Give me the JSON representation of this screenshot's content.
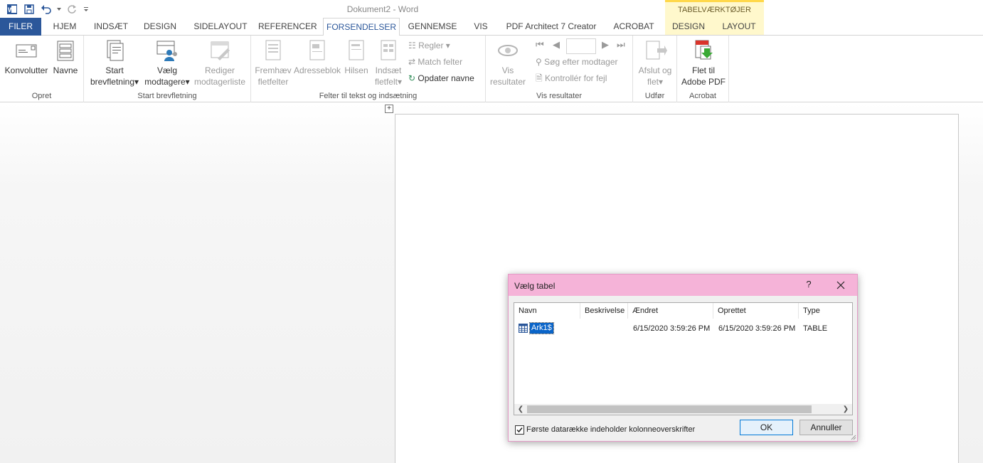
{
  "qat": {
    "icons": [
      "word-icon",
      "save-icon",
      "undo-icon",
      "undo-dropdown-icon",
      "redo-icon",
      "customize-qat-icon"
    ]
  },
  "window": {
    "title": "Dokument2 - Word"
  },
  "contextual": {
    "header": "TABELVÆRKTØJER"
  },
  "tabs": [
    {
      "label": "FILER"
    },
    {
      "label": "HJEM"
    },
    {
      "label": "INDSÆT"
    },
    {
      "label": "DESIGN"
    },
    {
      "label": "SIDELAYOUT"
    },
    {
      "label": "REFERENCER"
    },
    {
      "label": "FORSENDELSER"
    },
    {
      "label": "GENNEMSE"
    },
    {
      "label": "VIS"
    },
    {
      "label": "PDF Architect 7 Creator"
    },
    {
      "label": "ACROBAT"
    },
    {
      "label": "DESIGN"
    },
    {
      "label": "LAYOUT"
    }
  ],
  "ribbon": {
    "opret": {
      "label": "Opret",
      "konvolutter": "Konvolutter",
      "navne": "Navne"
    },
    "start": {
      "label": "Start brevfletning",
      "start_l1": "Start",
      "start_l2": "brevfletning",
      "vaelg_l1": "Vælg",
      "vaelg_l2": "modtagere",
      "rediger_l1": "Rediger",
      "rediger_l2": "modtagerliste"
    },
    "felter": {
      "label": "Felter til tekst og indsætning",
      "fremhaev_l1": "Fremhæv",
      "fremhaev_l2": "fletfelter",
      "adresseblok": "Adresseblok",
      "hilsen": "Hilsen",
      "indsaet_l1": "Indsæt",
      "indsaet_l2": "fletfelt",
      "regler": "Regler",
      "match": "Match felter",
      "opdater": "Opdater navne"
    },
    "vis": {
      "label": "Vis resultater",
      "vis_l1": "Vis",
      "vis_l2": "resultater",
      "soeg": "Søg efter modtager",
      "kontroller": "Kontrollér for fejl"
    },
    "udfoer": {
      "label": "Udfør",
      "afslut_l1": "Afslut og",
      "afslut_l2": "flet"
    },
    "acrobat": {
      "label": "Acrobat",
      "flet_l1": "Flet til",
      "flet_l2": "Adobe PDF"
    }
  },
  "document": {
    "table_move_handle": "+"
  },
  "dialog": {
    "title": "Vælg tabel",
    "help": "?",
    "columns": [
      "Navn",
      "Beskrivelse",
      "Ændret",
      "Oprettet",
      "Type"
    ],
    "rows": [
      {
        "navn": "Ark1$",
        "beskrivelse": "",
        "aendret": "6/15/2020 3:59:26 PM",
        "oprettet": "6/15/2020 3:59:26 PM",
        "type": "TABLE"
      }
    ],
    "checkbox_label": "Første datarække indeholder kolonneoverskrifter",
    "checkbox_checked": true,
    "ok": "OK",
    "cancel": "Annuller"
  }
}
